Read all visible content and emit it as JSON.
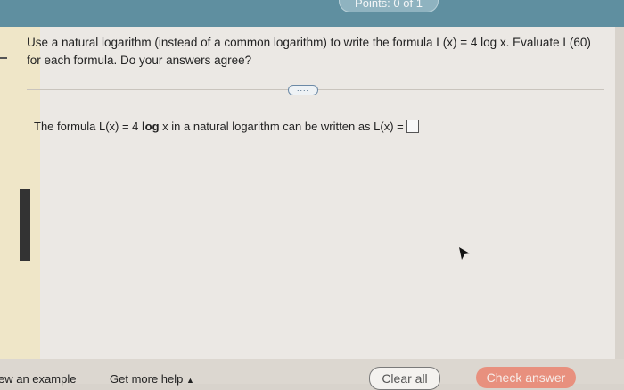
{
  "header": {
    "points_label": "Points: 0 of 1"
  },
  "question": {
    "text": "Use a natural logarithm (instead of a common logarithm) to write the formula L(x) = 4 log x. Evaluate L(60) for each formula. Do your answers agree?",
    "expand_label": "...."
  },
  "answer": {
    "prefix": "The formula L(x) = 4",
    "log_word": "log",
    "middle": "x in a natural logarithm can be written as L(x) =",
    "input_value": ""
  },
  "footer": {
    "view_example": "ew an example",
    "get_help": "Get more help",
    "clear_all": "Clear all",
    "check_answer": "Check answer"
  },
  "colors": {
    "top_bar": "#5f8fa0",
    "check_answer_bg": "#e8907e"
  }
}
